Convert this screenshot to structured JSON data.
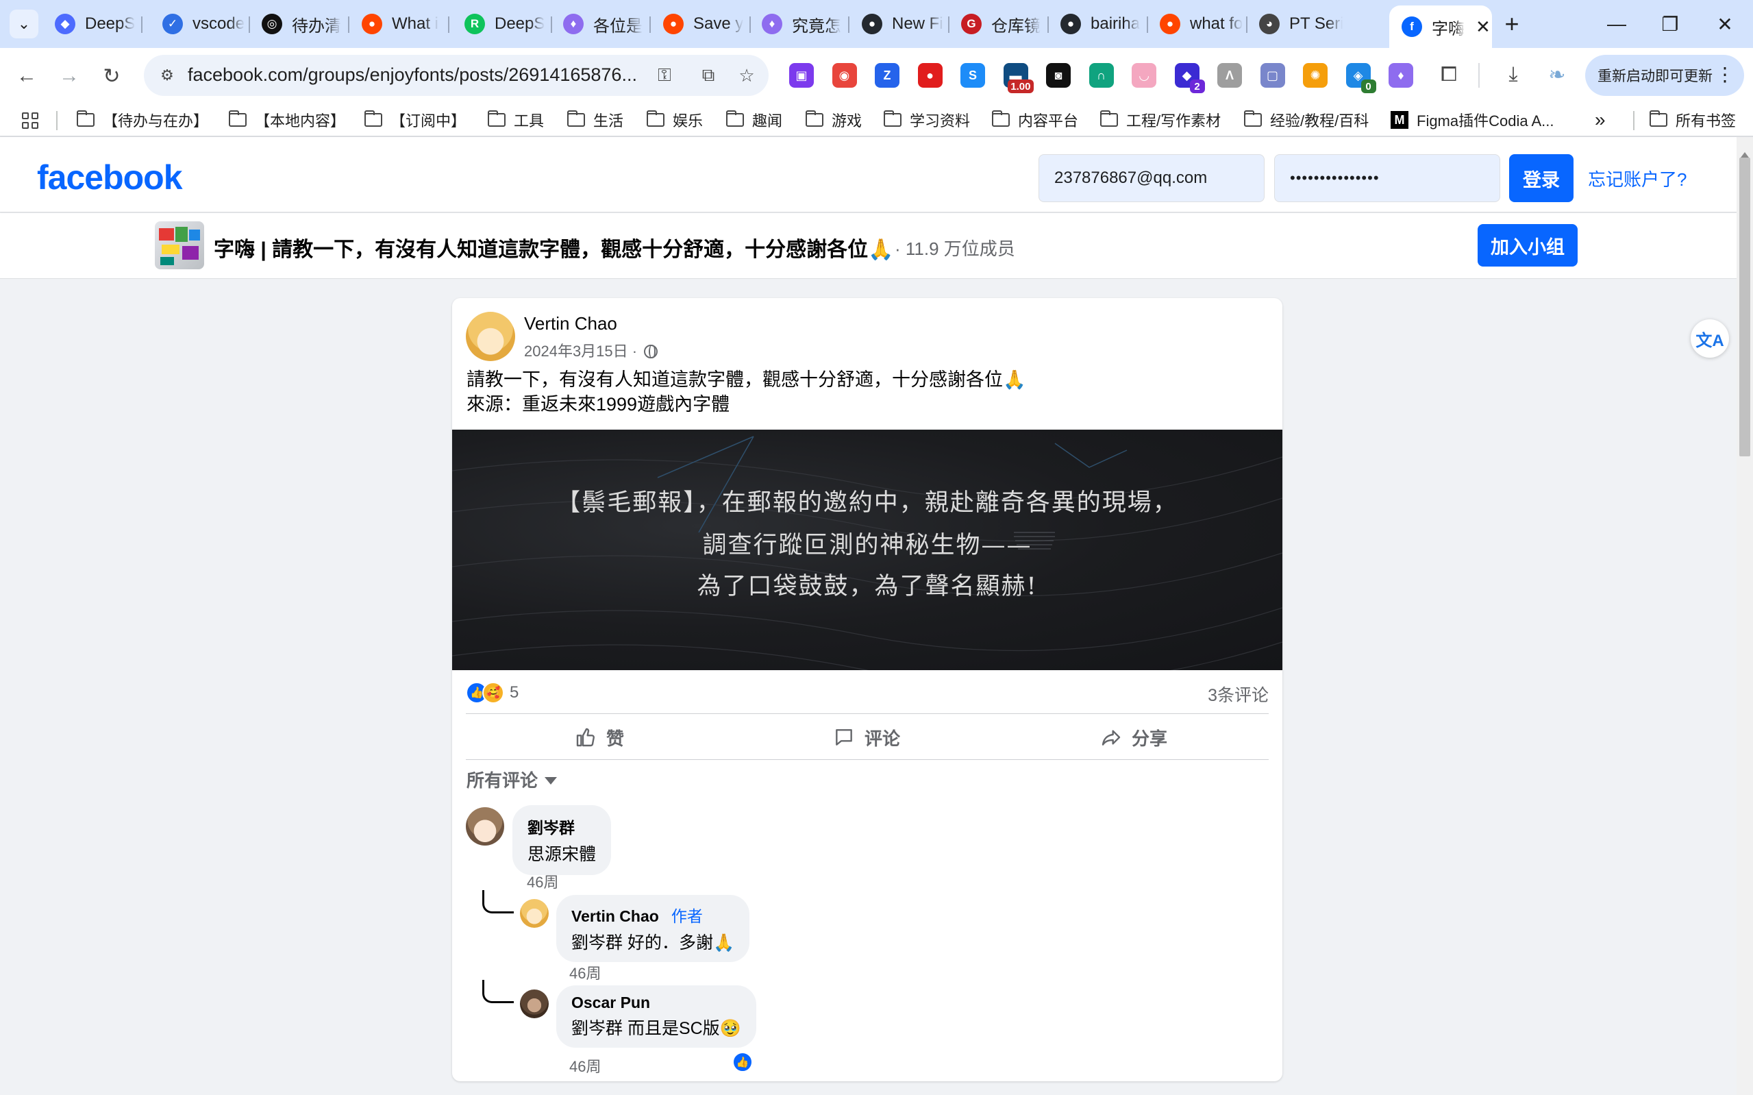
{
  "browser": {
    "tabs": [
      {
        "label": "DeepS",
        "icon": "deepseek-icon",
        "color": "#4d6bfe",
        "glyph": "◆"
      },
      {
        "label": "vscode",
        "icon": "todo-check-icon",
        "color": "#2f6fe4",
        "glyph": "✓"
      },
      {
        "label": "待办清",
        "icon": "chat-bubble-icon",
        "color": "#111111",
        "glyph": "◎"
      },
      {
        "label": "What i",
        "icon": "reddit-icon",
        "color": "#ff4500",
        "glyph": "●"
      },
      {
        "label": "DeepS",
        "icon": "green-r-icon",
        "color": "#0ec35b",
        "glyph": "R"
      },
      {
        "label": "各位是",
        "icon": "purple-leaf-icon",
        "color": "#8e6cef",
        "glyph": "♦"
      },
      {
        "label": "Save y",
        "icon": "reddit-icon",
        "color": "#ff4500",
        "glyph": "●"
      },
      {
        "label": "究竟怎",
        "icon": "purple-leaf-icon",
        "color": "#8e6cef",
        "glyph": "♦"
      },
      {
        "label": "New Fi",
        "icon": "github-icon",
        "color": "#24292f",
        "glyph": "●"
      },
      {
        "label": "仓库镜",
        "icon": "gitee-icon",
        "color": "#c71d23",
        "glyph": "G"
      },
      {
        "label": "bairiha",
        "icon": "github-icon",
        "color": "#24292f",
        "glyph": "●"
      },
      {
        "label": "what fo",
        "icon": "reddit-icon",
        "color": "#ff4500",
        "glyph": "●"
      },
      {
        "label": "PT Seri",
        "icon": "panda-icon",
        "color": "#444444",
        "glyph": "◕"
      },
      {
        "label": "字嗨",
        "icon": "facebook-icon",
        "color": "#0866ff",
        "glyph": "f"
      }
    ],
    "url": "facebook.com/groups/enjoyfonts/posts/26914165876...",
    "extensions": [
      {
        "icon": "purple-ext-icon",
        "color": "#7c3aed",
        "glyph": "▣",
        "badge": ""
      },
      {
        "icon": "color-ring-ext-icon",
        "color": "#e8453c",
        "glyph": "◉",
        "badge": ""
      },
      {
        "icon": "zotero-ext-icon",
        "color": "#2563eb",
        "glyph": "Z",
        "badge": ""
      },
      {
        "icon": "adblock-ext-icon",
        "color": "#e11d1d",
        "glyph": "●",
        "badge": ""
      },
      {
        "icon": "blue-s-ext-icon",
        "color": "#1d8cf8",
        "glyph": "S",
        "badge": ""
      },
      {
        "icon": "speed-ext-icon",
        "color": "#0f4c81",
        "glyph": "▬",
        "badge": "1.00",
        "badgeColor": "#c62828"
      },
      {
        "icon": "glasses-ext-icon",
        "color": "#111111",
        "glyph": "◙",
        "badge": ""
      },
      {
        "icon": "arch-ext-icon",
        "color": "#10a37f",
        "glyph": "∩",
        "badge": ""
      },
      {
        "icon": "cat-ext-icon",
        "color": "#f4a7c0",
        "glyph": "◡",
        "badge": ""
      },
      {
        "icon": "cube-ext-icon",
        "color": "#3b2bd3",
        "glyph": "◆",
        "badge": "2",
        "badgeColor": "#6d28d9"
      },
      {
        "icon": "mountain-ext-icon",
        "color": "#9e9e9e",
        "glyph": "Λ",
        "badge": ""
      },
      {
        "icon": "square-ext-icon",
        "color": "#7986cb",
        "glyph": "▢",
        "badge": ""
      },
      {
        "icon": "globe-ext-icon",
        "color": "#f59e0b",
        "glyph": "✺",
        "badge": ""
      },
      {
        "icon": "shield-ext-icon",
        "color": "#1e88e5",
        "glyph": "◈",
        "badge": "0",
        "badgeColor": "#2e7d32"
      },
      {
        "icon": "purple-leaf-ext-icon",
        "color": "#8e6cef",
        "glyph": "♦",
        "badge": ""
      }
    ],
    "update_label": "重新启动即可更新",
    "bookmarks": [
      "【待办与在办】",
      "【本地内容】",
      "【订阅中】",
      "工具",
      "生活",
      "娱乐",
      "趣闻",
      "游戏",
      "学习资料",
      "内容平台",
      "工程/写作素材",
      "经验/教程/百科",
      "Figma插件Codia A...",
      "所有书签"
    ],
    "bookmarks_more": "»"
  },
  "facebook": {
    "logo": "facebook",
    "email_value": "237876867@qq.com",
    "password_value": "•••••••••••••••",
    "login_label": "登录",
    "forgot_label": "忘记账户了?",
    "group_title": "字嗨 | 請教一下，有沒有人知道這款字體，觀感十分舒適，十分感謝各位🙏",
    "group_members": "· 11.9 万位成员",
    "join_label": "加入小组",
    "translate_glyph": "文A"
  },
  "post": {
    "author": "Vertin Chao",
    "date": "2024年3月15日 ·",
    "text_line1": "請教一下，有沒有人知道這款字體，觀感十分舒適，十分感謝各位🙏",
    "text_line2": "來源：重返未來1999遊戲內字體",
    "image_lines": [
      "【鬃毛郵報】，在郵報的邀約中，親赴離奇各異的現場，",
      "調查行蹤叵測的神秘生物——",
      "為了口袋鼓鼓，為了聲名顯赫!"
    ],
    "reaction_count": "5",
    "comment_count": "3条评论",
    "actions": {
      "like": "赞",
      "comment": "评论",
      "share": "分享"
    },
    "all_comments_label": "所有评论",
    "comments": [
      {
        "name": "劉岑群",
        "text": "思源宋體",
        "time": "46周"
      },
      {
        "name": "Vertin Chao",
        "tag": "作者",
        "text": "劉岑群 好的．多謝🙏",
        "time": "46周"
      },
      {
        "name": "Oscar Pun",
        "text": "劉岑群 而且是SC版🥹",
        "time": "46周"
      }
    ]
  }
}
